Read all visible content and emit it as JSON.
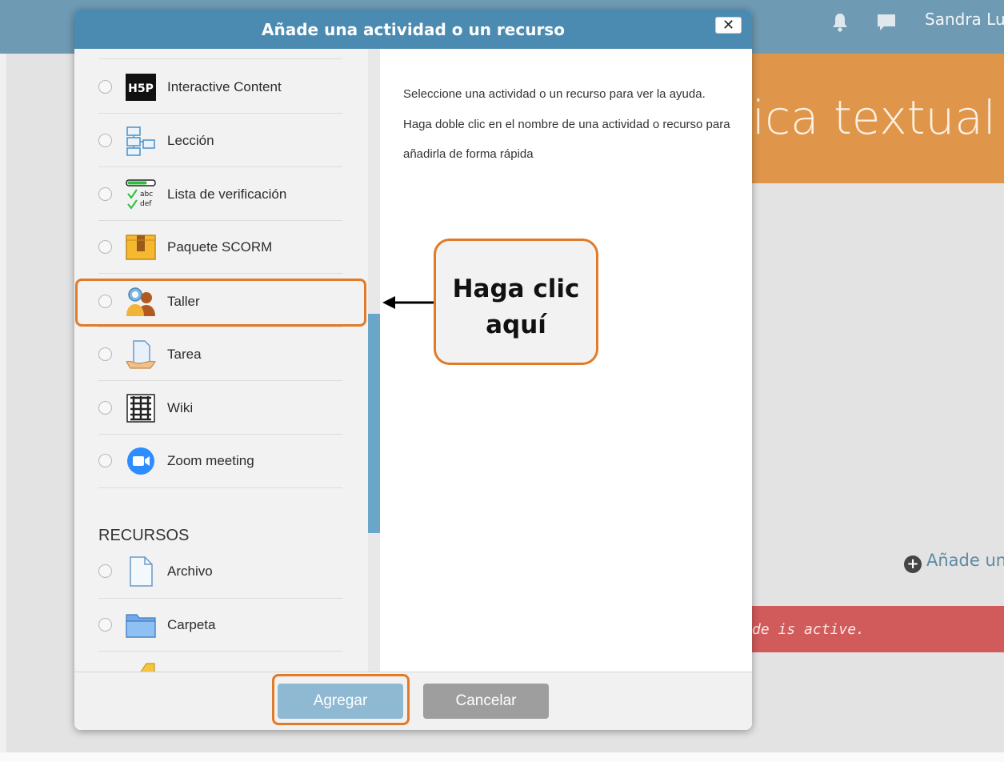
{
  "background": {
    "user_name": "Sandra Lu",
    "course_title_partial": "ica textual",
    "add_activity_partial": "Añade un",
    "alert_partial": "de is active."
  },
  "dialog": {
    "title": "Añade una actividad o un recurso",
    "close_label": "✕",
    "help_text": "Seleccione una actividad o un recurso para ver la ayuda. Haga doble clic en el nombre de una actividad o recurso para añadirla de forma rápida",
    "activities": [
      {
        "label": "Interactive Content",
        "icon": "h5p-icon"
      },
      {
        "label": "Lección",
        "icon": "lesson-icon"
      },
      {
        "label": "Lista de verificación",
        "icon": "checklist-icon"
      },
      {
        "label": "Paquete SCORM",
        "icon": "scorm-package-icon"
      },
      {
        "label": "Taller",
        "icon": "workshop-icon"
      },
      {
        "label": "Tarea",
        "icon": "assignment-icon"
      },
      {
        "label": "Wiki",
        "icon": "wiki-icon"
      },
      {
        "label": "Zoom meeting",
        "icon": "zoom-icon"
      }
    ],
    "resources_heading": "RECURSOS",
    "resources": [
      {
        "label": "Archivo",
        "icon": "file-icon"
      },
      {
        "label": "Carpeta",
        "icon": "folder-icon"
      }
    ],
    "add_button": "Agregar",
    "cancel_button": "Cancelar"
  },
  "annotation": {
    "callout_text": "Haga clic aquí"
  },
  "colors": {
    "header_blue": "#4b8bb1",
    "highlight_orange": "#e07b2a",
    "course_orange": "#e0964a",
    "alert_red": "#d15a5a"
  }
}
